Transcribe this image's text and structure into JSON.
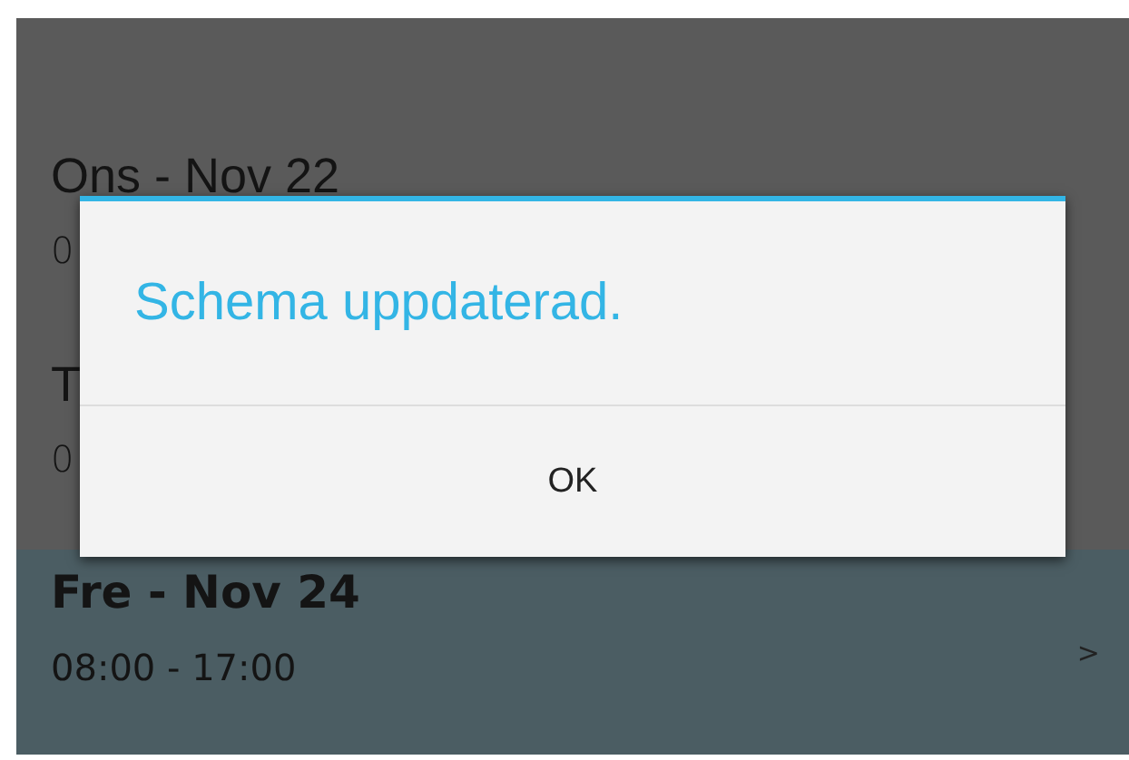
{
  "schedule": [
    {
      "title": "Ons - Nov 22",
      "hours": "0",
      "selected": false
    },
    {
      "title": "T",
      "hours": "0",
      "selected": false
    },
    {
      "title": "Fre - Nov 24",
      "hours": "08:00 - 17:00",
      "selected": true,
      "chevron": ">"
    }
  ],
  "dialog": {
    "message": "Schema uppdaterad.",
    "button": "OK"
  }
}
